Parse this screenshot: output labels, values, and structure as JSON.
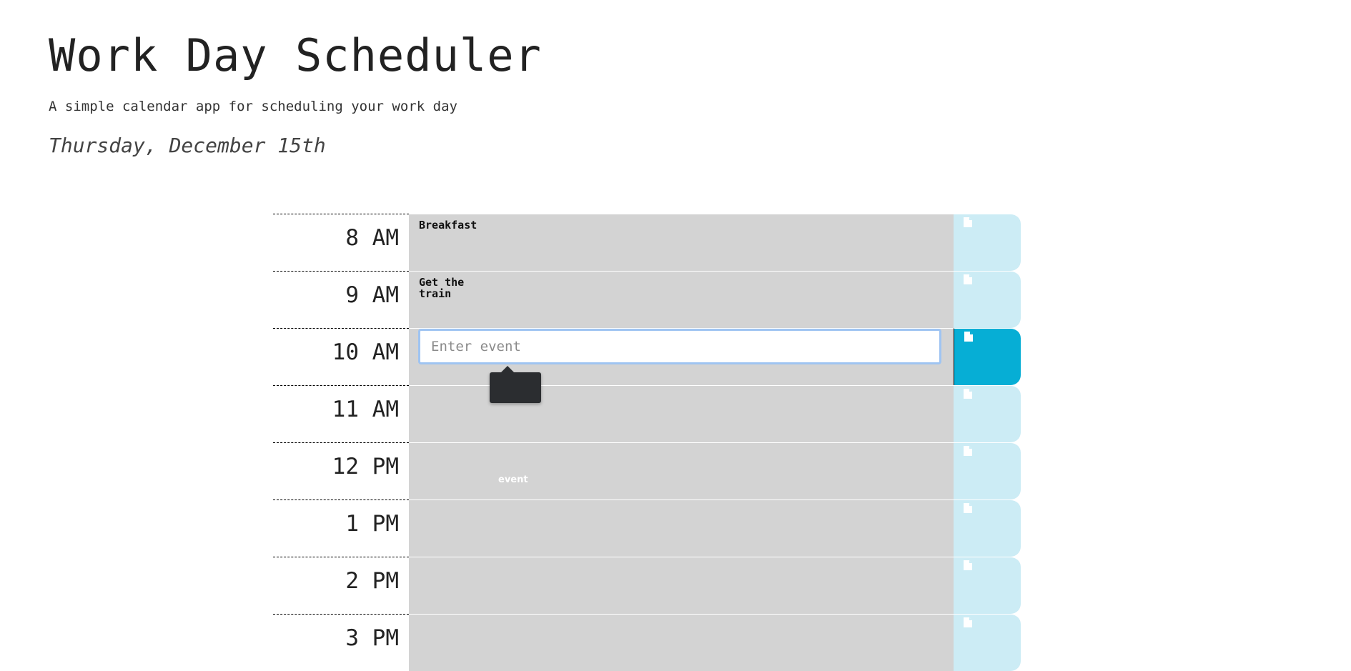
{
  "header": {
    "title": "Work Day Scheduler",
    "subtitle": "A simple calendar app for scheduling your work day",
    "current_day": "Thursday, December 15th"
  },
  "colors": {
    "past": "#d3d3d3",
    "save_button": "#ccecf5",
    "save_button_active": "#06aed5",
    "input_focus_border": "#9fc4f2",
    "tooltip_bg": "#2b2d30"
  },
  "schedule": {
    "rows": [
      {
        "hour": "8 AM",
        "event": "Breakfast"
      },
      {
        "hour": "9 AM",
        "event": "Get the\ntrain"
      },
      {
        "hour": "10 AM",
        "event": "",
        "input_placeholder": "Enter event",
        "tooltip": "event"
      },
      {
        "hour": "11 AM",
        "event": ""
      },
      {
        "hour": "12 PM",
        "event": ""
      },
      {
        "hour": "1 PM",
        "event": ""
      },
      {
        "hour": "2 PM",
        "event": ""
      },
      {
        "hour": "3 PM",
        "event": ""
      }
    ],
    "save_icon": "file-icon"
  }
}
